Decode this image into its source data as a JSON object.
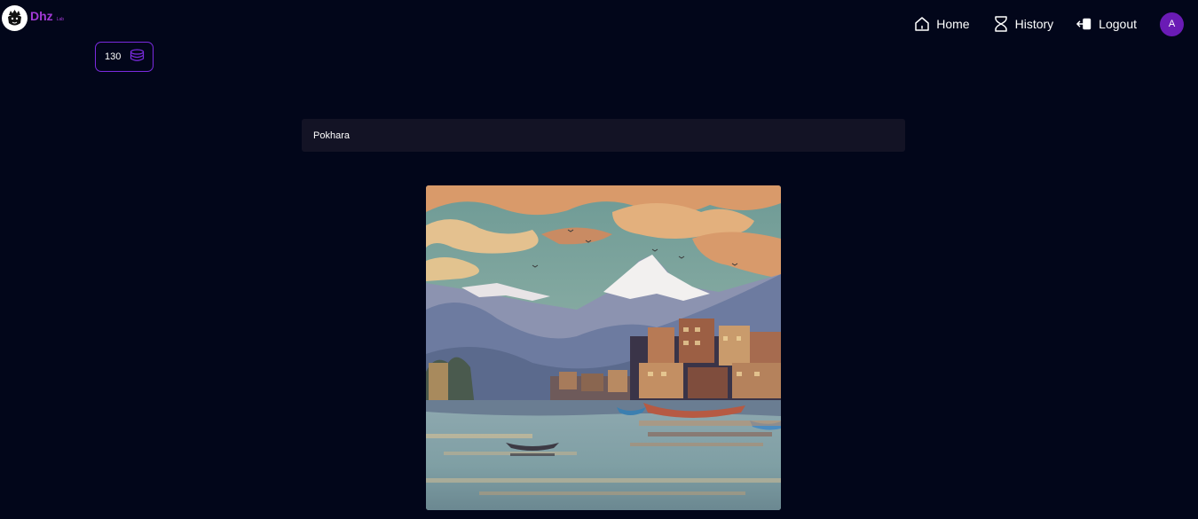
{
  "brand": {
    "name": "Dhz",
    "suffix": "Lab",
    "accent_color": "#a23ad6"
  },
  "nav": {
    "items": [
      {
        "label": "Home",
        "icon": "home-icon"
      },
      {
        "label": "History",
        "icon": "hourglass-icon"
      },
      {
        "label": "Logout",
        "icon": "logout-icon"
      }
    ],
    "avatar_initial": "A"
  },
  "credits": {
    "value": "130",
    "icon": "coins-icon",
    "border_color": "#7b2be0"
  },
  "prompt": {
    "value": "Pokhara"
  },
  "result": {
    "icon": "generated-image"
  }
}
